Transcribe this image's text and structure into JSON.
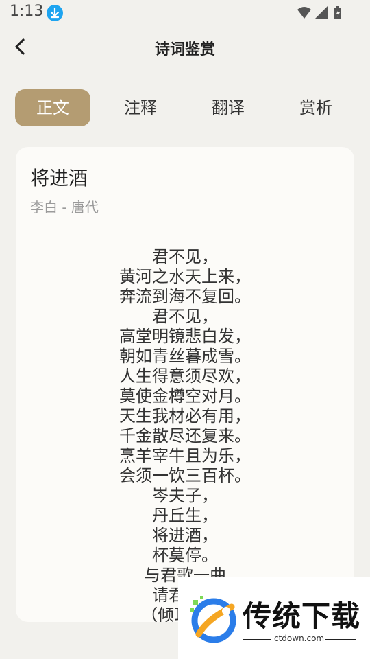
{
  "status_bar": {
    "time": "1:13"
  },
  "header": {
    "title": "诗词鉴赏"
  },
  "tabs": [
    {
      "label": "正文",
      "active": true
    },
    {
      "label": "注释",
      "active": false
    },
    {
      "label": "翻译",
      "active": false
    },
    {
      "label": "赏析",
      "active": false
    }
  ],
  "poem": {
    "title": "将进酒",
    "meta": "李白 - 唐代",
    "lines": [
      "君不见，",
      "黄河之水天上来，",
      "奔流到海不复回。",
      "君不见，",
      "高堂明镜悲白发，",
      "朝如青丝暮成雪。",
      "人生得意须尽欢，",
      "莫使金樽空对月。",
      "天生我材必有用，",
      "千金散尽还复来。",
      "烹羊宰牛且为乐，",
      "会须一饮三百杯。",
      "岑夫子，",
      "丹丘生，",
      "将进酒，",
      "杯莫停。",
      "与君歌一曲",
      "请君为我",
      "（倾耳听 一"
    ]
  },
  "watermark": {
    "brand": "传统下载",
    "url": "ctdown.com"
  },
  "colors": {
    "accent": "#b49c72",
    "background": "#f2f1ed",
    "card": "#fcfbf8"
  }
}
